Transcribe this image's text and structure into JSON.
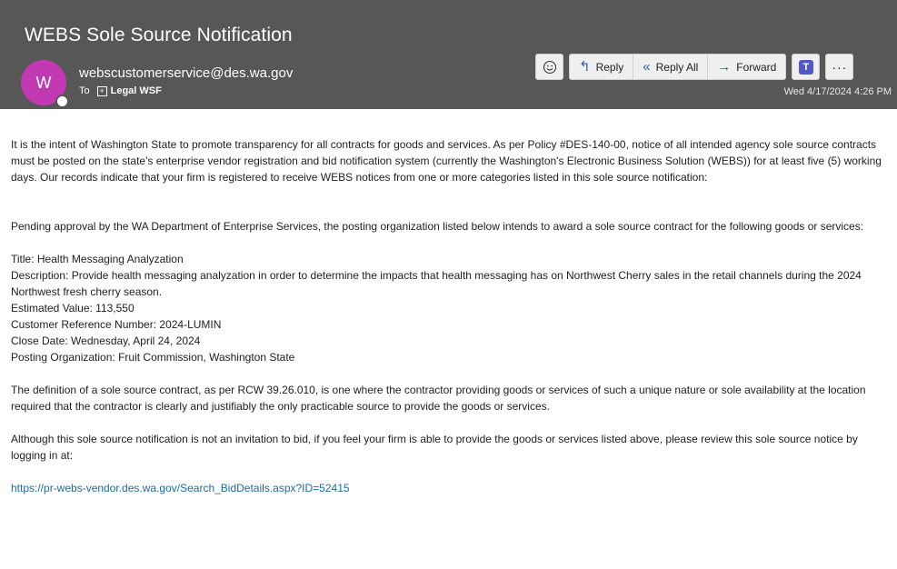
{
  "header": {
    "subject": "WEBS Sole Source Notification",
    "avatar_initial": "W",
    "sender": "webscustomerservice@des.wa.gov",
    "to_label": "To",
    "recipient": "Legal WSF",
    "timestamp": "Wed 4/17/2024 4:26 PM"
  },
  "toolbar": {
    "reply_label": "Reply",
    "reply_all_label": "Reply All",
    "forward_label": "Forward",
    "more_label": "···"
  },
  "icons": [
    "emoji-icon",
    "reply-icon",
    "reply-all-icon",
    "forward-icon",
    "teams-icon",
    "more-icon",
    "expand-icon"
  ],
  "colors": {
    "header_bg": "#575757",
    "avatar_bg": "#c239b3",
    "link": "#1c6ba0",
    "action_icon": "#2b5fb3"
  },
  "message": {
    "intro": "It is the intent of Washington State to promote transparency for all contracts for goods and services.  As per Policy #DES-140-00, notice of all intended agency sole source contracts must be posted on the state's enterprise vendor registration and bid notification system (currently the Washington's Electronic Business Solution (WEBS)) for at least five (5) working days.  Our records indicate that your firm is registered to receive WEBS notices from one or more categories listed in this sole source notification:",
    "pending": "Pending approval by the WA Department of Enterprise Services, the posting organization listed below intends to award a sole source contract for the following goods or services:",
    "title": "Title: Health Messaging Analyzation",
    "description": "Description: Provide health messaging analyzation in order to determine the impacts that health messaging has on Northwest Cherry sales in the retail channels during the 2024 Northwest fresh cherry season.",
    "estimated_value": "Estimated Value: 113,550",
    "customer_ref": "Customer Reference Number: 2024-LUMIN",
    "close_date": "Close Date: Wednesday, April 24, 2024",
    "posting_org": "Posting Organization: Fruit Commission, Washington State",
    "definition": "The definition of a sole source contract, as per RCW 39.26.010, is one where the contractor providing goods or services of such a unique nature or sole availability at the location required that the contractor is clearly and justifiably the only practicable source to provide the goods or services.",
    "review": "Although this sole source notification is not an invitation to bid, if you feel your firm is able to provide the goods or services listed above, please review this sole source notice by logging in at:",
    "link": "https://pr-webs-vendor.des.wa.gov/Search_BidDetails.aspx?ID=52415"
  }
}
